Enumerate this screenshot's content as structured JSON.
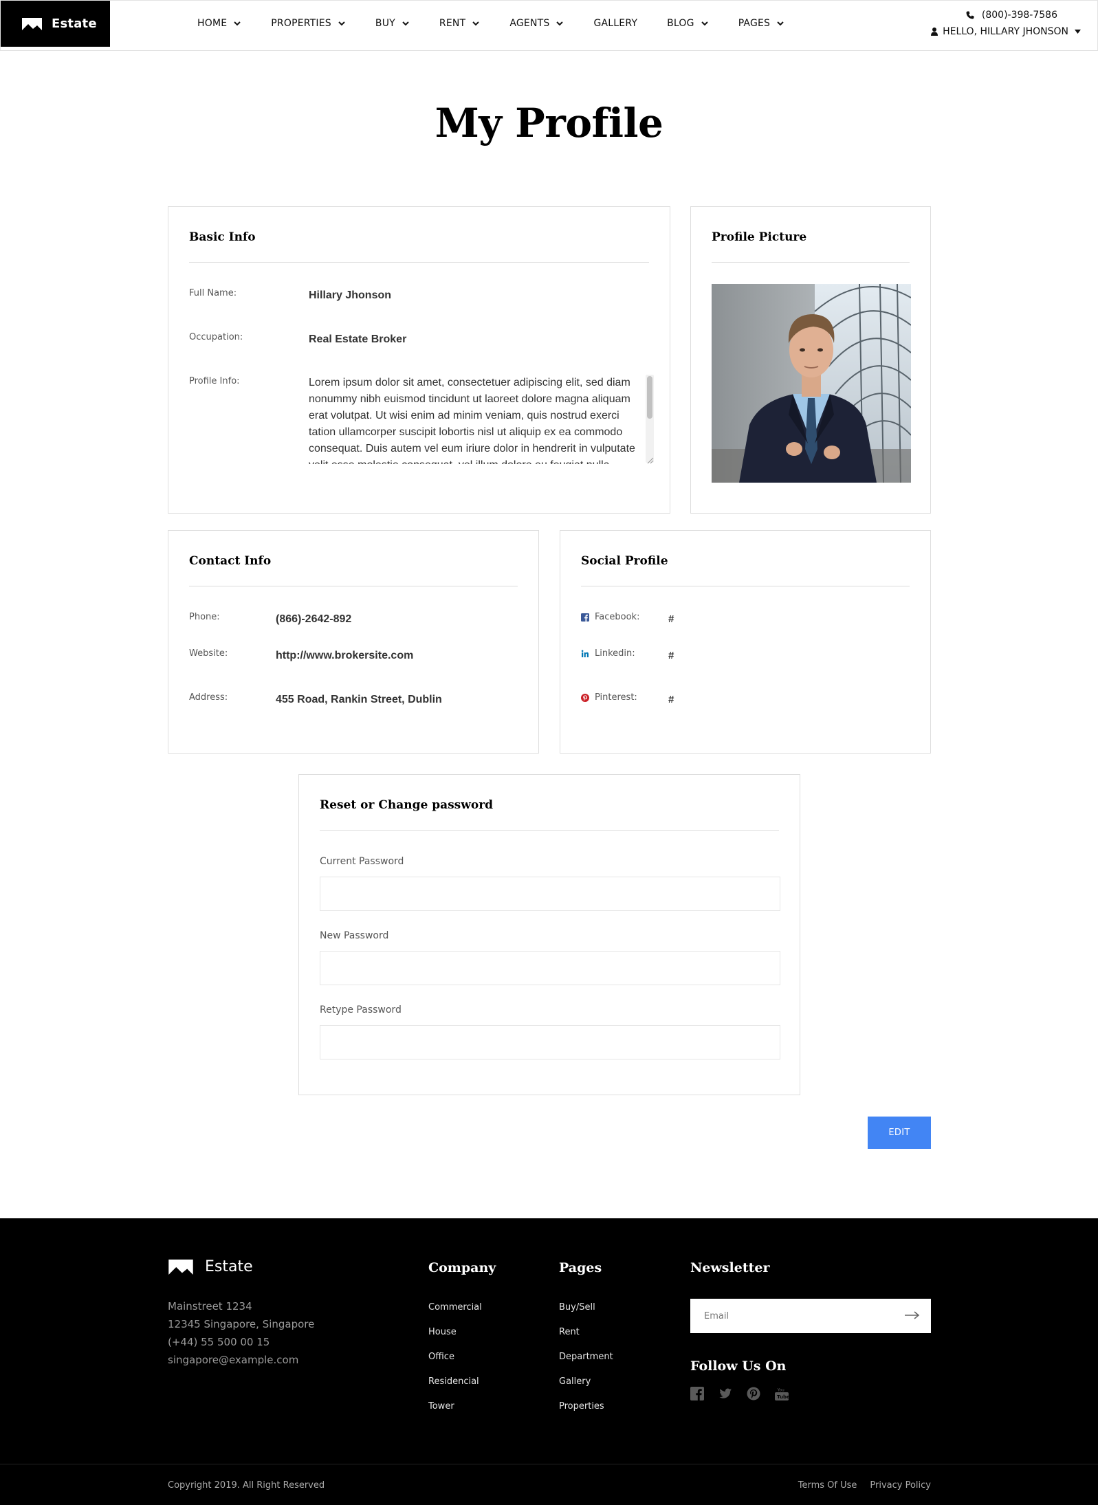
{
  "header": {
    "logo_text": "Estate",
    "nav": [
      {
        "label": "HOME",
        "dropdown": true
      },
      {
        "label": "PROPERTIES",
        "dropdown": true
      },
      {
        "label": "BUY",
        "dropdown": true
      },
      {
        "label": "RENT",
        "dropdown": true
      },
      {
        "label": "AGENTS",
        "dropdown": true
      },
      {
        "label": "GALLERY",
        "dropdown": false
      },
      {
        "label": "BLOG",
        "dropdown": true
      },
      {
        "label": "PAGES",
        "dropdown": true
      }
    ],
    "phone": "(800)-398-7586",
    "user_greeting": "HELLO, HILLARY JHONSON"
  },
  "page_title": "My Profile",
  "basic_info": {
    "title": "Basic Info",
    "full_name_label": "Full Name:",
    "full_name": "Hillary Jhonson",
    "occupation_label": "Occupation:",
    "occupation": "Real Estate Broker",
    "profile_info_label": "Profile Info:",
    "profile_info": "Lorem ipsum dolor sit amet, consectetuer adipiscing elit, sed diam nonummy nibh euismod tincidunt ut laoreet dolore magna aliquam erat volutpat. Ut wisi enim ad minim veniam, quis nostrud exerci tation ullamcorper suscipit lobortis nisl ut aliquip ex ea commodo consequat. Duis autem vel eum iriure dolor in hendrerit in vulputate velit esse molestie consequat, vel illum dolore eu feugiat nulla facilisis."
  },
  "profile_picture": {
    "title": "Profile Picture"
  },
  "contact_info": {
    "title": "Contact Info",
    "phone_label": "Phone:",
    "phone": "(866)-2642-892",
    "website_label": "Website:",
    "website": "http://www.brokersite.com",
    "address_label": "Address:",
    "address": "455 Road, Rankin Street, Dublin"
  },
  "social_profile": {
    "title": "Social Profile",
    "items": [
      {
        "label": "Facebook:",
        "value": "#",
        "icon": "facebook-icon",
        "color": "#3b5998"
      },
      {
        "label": "Linkedin:",
        "value": "#",
        "icon": "linkedin-icon",
        "color": "#0077b5"
      },
      {
        "label": "Pinterest:",
        "value": "#",
        "icon": "pinterest-icon",
        "color": "#cb2027"
      }
    ]
  },
  "password": {
    "title": "Reset or Change password",
    "current_label": "Current Password",
    "new_label": "New Password",
    "retype_label": "Retype Password",
    "current_value": "",
    "new_value": "",
    "retype_value": ""
  },
  "edit_button": "EDIT",
  "colors": {
    "accent": "#4285f4",
    "footer_bg": "#000000"
  },
  "footer": {
    "logo_text": "Estate",
    "address_lines": [
      "Mainstreet 1234",
      "12345 Singapore, Singapore",
      "(+44) 55 500 00 15",
      "singapore@example.com"
    ],
    "company_title": "Company",
    "company_links": [
      "Commercial",
      "House",
      "Office",
      "Residencial",
      "Tower"
    ],
    "pages_title": "Pages",
    "pages_links": [
      "Buy/Sell",
      "Rent",
      "Department",
      "Gallery",
      "Properties"
    ],
    "newsletter_title": "Newsletter",
    "email_placeholder": "Email",
    "follow_title": "Follow Us On",
    "follow_icons": [
      "facebook-icon",
      "twitter-icon",
      "pinterest-icon",
      "youtube-icon"
    ],
    "copyright": "Copyright 2019. All Right Reserved",
    "terms": "Terms Of Use",
    "privacy": "Privacy Policy"
  }
}
